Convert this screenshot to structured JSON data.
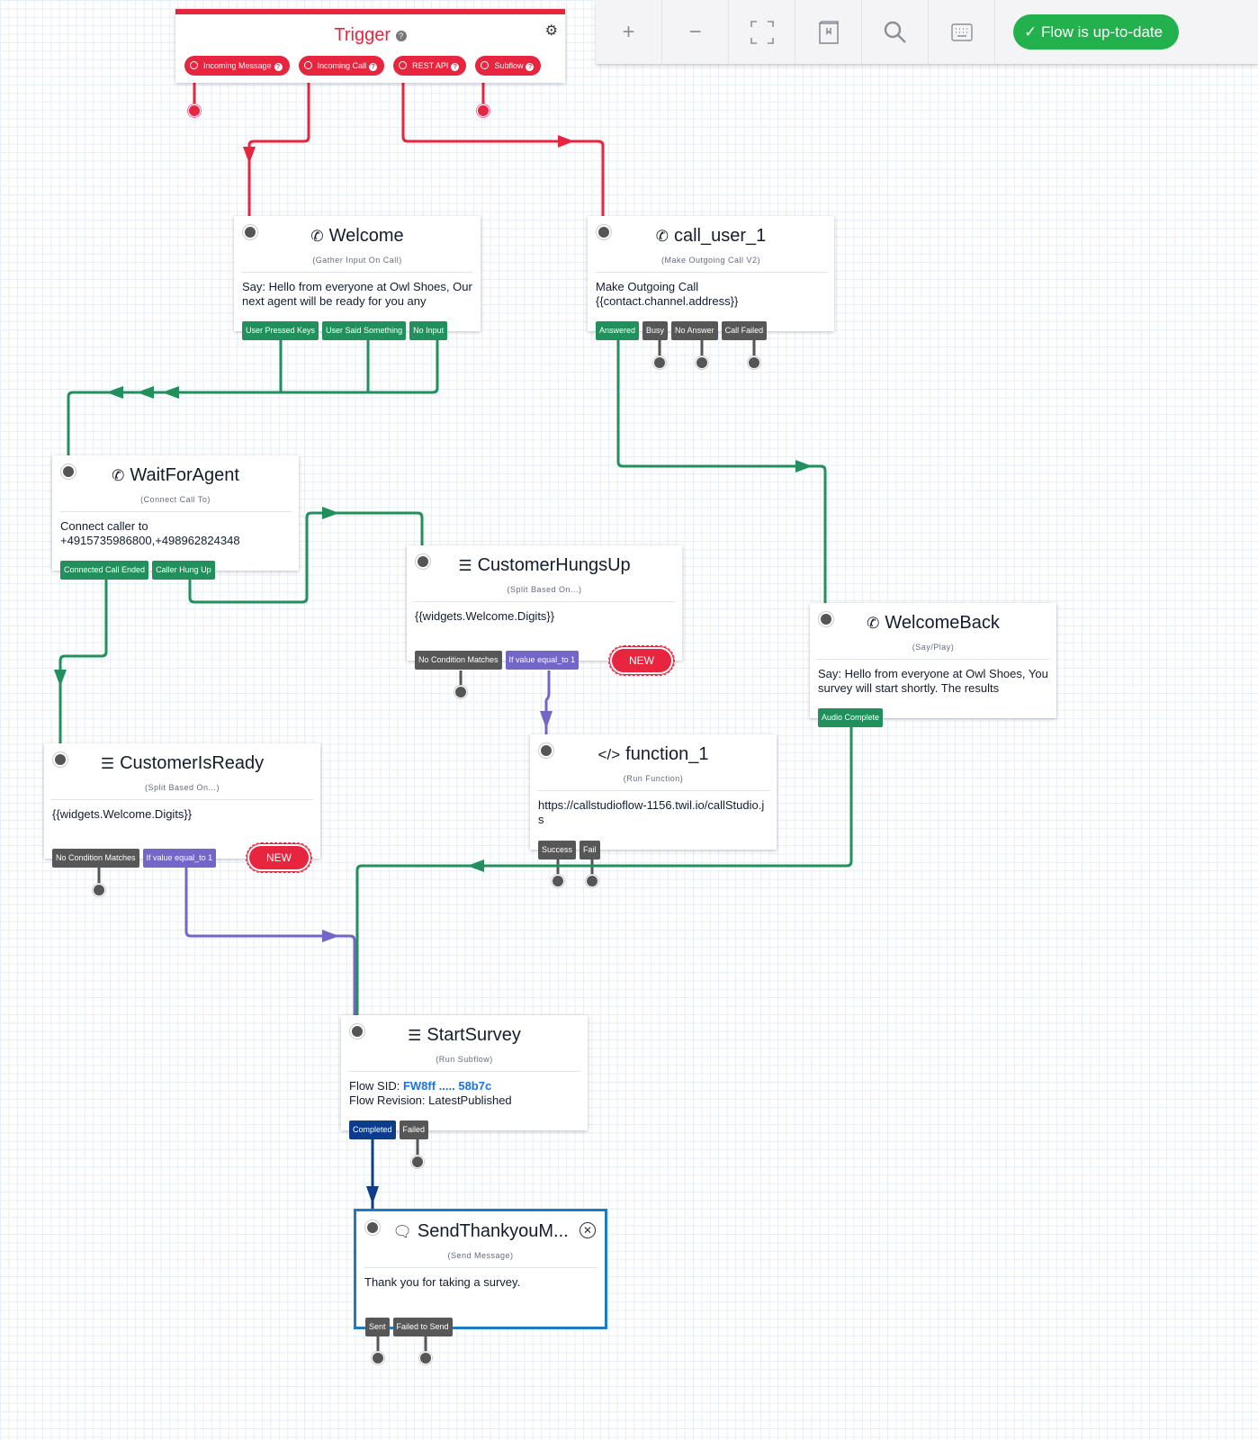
{
  "toolbar": {
    "buttons": [
      {
        "name": "zoom-in",
        "icon": "+"
      },
      {
        "name": "zoom-out",
        "icon": "−"
      },
      {
        "name": "fit-screen",
        "icon": "⛶"
      },
      {
        "name": "docs",
        "icon": "▯"
      },
      {
        "name": "search",
        "icon": "⌕"
      },
      {
        "name": "keyboard",
        "icon": "⌨"
      }
    ],
    "status_icon": "✓",
    "status_label": "Flow is up-to-date"
  },
  "trigger": {
    "title": "Trigger",
    "help_icon": "?",
    "settings_icon": "⚙",
    "pills": [
      {
        "label": "Incoming Message"
      },
      {
        "label": "Incoming Call"
      },
      {
        "label": "REST API"
      },
      {
        "label": "Subflow"
      }
    ]
  },
  "widgets": {
    "welcome": {
      "icon": "✆",
      "title": "Welcome",
      "type": "(Gather Input On Call)",
      "body": "Say: Hello from everyone at Owl Shoes, Our next agent will be ready for you any",
      "ports": [
        "User Pressed Keys",
        "User Said Something",
        "No Input"
      ]
    },
    "call_user_1": {
      "icon": "✆",
      "title": "call_user_1",
      "type": "(Make Outgoing Call V2)",
      "body": "Make Outgoing Call {{contact.channel.address}}",
      "ports": [
        "Answered",
        "Busy",
        "No Answer",
        "Call Failed"
      ]
    },
    "wait_for_agent": {
      "icon": "✆",
      "title": "WaitForAgent",
      "type": "(Connect Call To)",
      "body": "Connect caller to +4915735986800,+498962824348",
      "ports": [
        "Connected Call Ended",
        "Caller Hung Up"
      ]
    },
    "customer_hungs_up": {
      "icon": "☰",
      "title": "CustomerHungsUp",
      "type": "(Split Based On...)",
      "body": "{{widgets.Welcome.Digits}}",
      "ports": [
        "No Condition Matches",
        "If value equal_to 1"
      ],
      "new_label": "NEW"
    },
    "welcome_back": {
      "icon": "✆",
      "title": "WelcomeBack",
      "type": "(Say/Play)",
      "body": "Say: Hello from everyone at Owl Shoes, You survey will start shortly. The results",
      "ports": [
        "Audio Complete"
      ]
    },
    "function_1": {
      "icon": "</>",
      "title": "function_1",
      "type": "(Run Function)",
      "body": "https://callstudioflow-1156.twil.io/callStudio.js",
      "ports": [
        "Success",
        "Fail"
      ]
    },
    "customer_is_ready": {
      "icon": "☰",
      "title": "CustomerIsReady",
      "type": "(Split Based On...)",
      "body": "{{widgets.Welcome.Digits}}",
      "ports": [
        "No Condition Matches",
        "If value equal_to 1"
      ],
      "new_label": "NEW"
    },
    "start_survey": {
      "icon": "☰",
      "title": "StartSurvey",
      "type": "(Run Subflow)",
      "sid_label": "Flow SID: ",
      "sid_value": "FW8ff ..... 58b7c",
      "revision": "Flow Revision: LatestPublished",
      "ports": [
        "Completed",
        "Failed"
      ]
    },
    "send_thankyou": {
      "icon": "🗨",
      "title": "SendThankyouM...",
      "type": "(Send Message)",
      "body": "Thank you for taking a survey.",
      "ports": [
        "Sent",
        "Failed to Send"
      ],
      "close_icon": "✕"
    }
  },
  "colors": {
    "trigger_red": "#e8253e",
    "success_green": "#22905c",
    "status_green": "#22b14c",
    "split_purple": "#7266c8",
    "subflow_navy": "#0b3d8c",
    "neutral_gray": "#575757",
    "selected_blue": "#1d7bc6"
  }
}
